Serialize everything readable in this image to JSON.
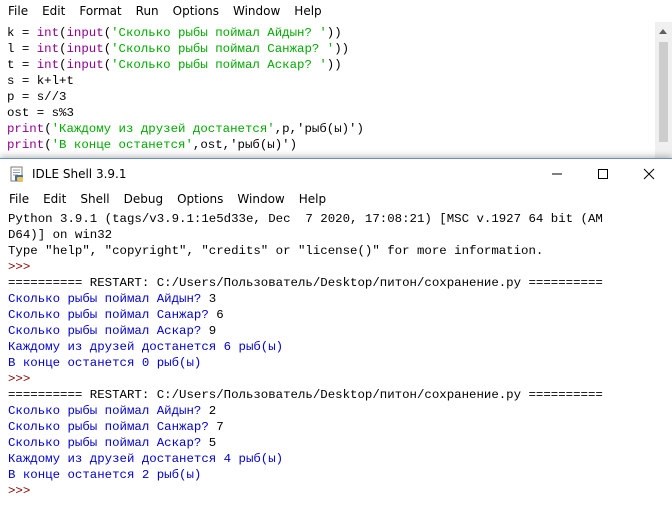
{
  "editor": {
    "menu": [
      "File",
      "Edit",
      "Format",
      "Run",
      "Options",
      "Window",
      "Help"
    ],
    "code": [
      {
        "pre": "k = ",
        "kw": "int",
        "mid": "(",
        "kw2": "input",
        "open": "(",
        "str": "'Сколько рыбы поймал Айдын? '",
        "post": "))"
      },
      {
        "pre": "l = ",
        "kw": "int",
        "mid": "(",
        "kw2": "input",
        "open": "(",
        "str": "'Сколько рыбы поймал Санжар? '",
        "post": "))"
      },
      {
        "pre": "t = ",
        "kw": "int",
        "mid": "(",
        "kw2": "input",
        "open": "(",
        "str": "'Сколько рыбы поймал Аскар? '",
        "post": "))"
      },
      {
        "pre": "s = k+l+t",
        "kw": "",
        "mid": "",
        "kw2": "",
        "open": "",
        "str": "",
        "post": ""
      },
      {
        "pre": "p = s//3",
        "kw": "",
        "mid": "",
        "kw2": "",
        "open": "",
        "str": "",
        "post": ""
      },
      {
        "pre": "ost = s%3",
        "kw": "",
        "mid": "",
        "kw2": "",
        "open": "",
        "str": "",
        "post": ""
      },
      {
        "pre": "",
        "kw": "print",
        "mid": "(",
        "kw2": "",
        "open": "",
        "str": "'Каждому из друзей достанется'",
        "post": ",p,'рыб(ы)')"
      },
      {
        "pre": "",
        "kw": "print",
        "mid": "(",
        "kw2": "",
        "open": "",
        "str": "'В конце останется'",
        "post": ",ost,'рыб(ы)')"
      }
    ]
  },
  "shell": {
    "title": "IDLE Shell 3.9.1",
    "menu": [
      "File",
      "Edit",
      "Shell",
      "Debug",
      "Options",
      "Window",
      "Help"
    ],
    "header": [
      "Python 3.9.1 (tags/v3.9.1:1e5d33e, Dec  7 2020, 17:08:21) [MSC v.1927 64 bit (AM",
      "D64)] on win32",
      "Type \"help\", \"copyright\", \"credits\" or \"license()\" for more information."
    ],
    "prompt": ">>>",
    "restart": "========== RESTART: C:/Users/Пользователь/Desktop/питон/сохранение.py ==========",
    "run1": {
      "q1": "Сколько рыбы поймал Айдын? ",
      "a1": "3",
      "q2": "Сколько рыбы поймал Санжар? ",
      "a2": "6",
      "q3": "Сколько рыбы поймал Аскар? ",
      "a3": "9",
      "out1": "Каждому из друзей достанется 6 рыб(ы)",
      "out2": "В конце останется 0 рыб(ы)"
    },
    "run2": {
      "q1": "Сколько рыбы поймал Айдын? ",
      "a1": "2",
      "q2": "Сколько рыбы поймал Санжар? ",
      "a2": "7",
      "q3": "Сколько рыбы поймал Аскар? ",
      "a3": "5",
      "out1": "Каждому из друзей достанется 4 рыб(ы)",
      "out2": "В конце останется 2 рыб(ы)"
    }
  }
}
